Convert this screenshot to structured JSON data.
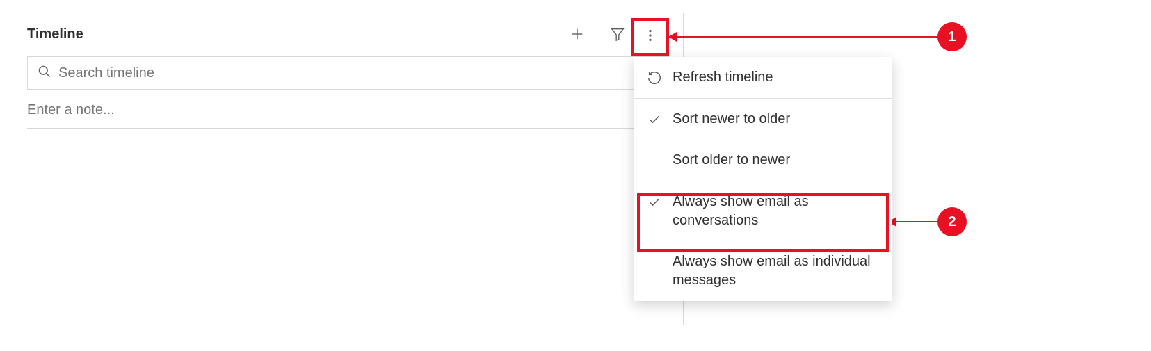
{
  "panel": {
    "title": "Timeline",
    "search_placeholder": "Search timeline",
    "note_placeholder": "Enter a note..."
  },
  "dropdown": {
    "refresh": "Refresh timeline",
    "sort_newer": "Sort newer to older",
    "sort_older": "Sort older to newer",
    "email_conversations": "Always show email as conversations",
    "email_individual": "Always show email as individual messages"
  },
  "callouts": {
    "c1": "1",
    "c2": "2"
  }
}
